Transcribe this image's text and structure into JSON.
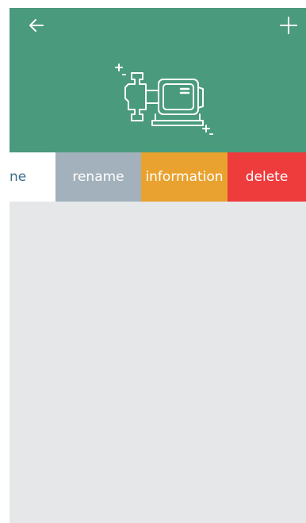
{
  "topbar": {
    "back_icon": "back-arrow-icon",
    "add_icon": "plus-icon"
  },
  "hero": {
    "icon": "pump-icon"
  },
  "row": {
    "name_partial": "ne",
    "actions": {
      "rename": "rename",
      "information": "information",
      "delete": "delete"
    }
  },
  "colors": {
    "header": "#4a9a7d",
    "rename": "#a2b1bb",
    "information": "#e9a22f",
    "delete": "#ee3b3c",
    "background": "#e6e7e9"
  }
}
